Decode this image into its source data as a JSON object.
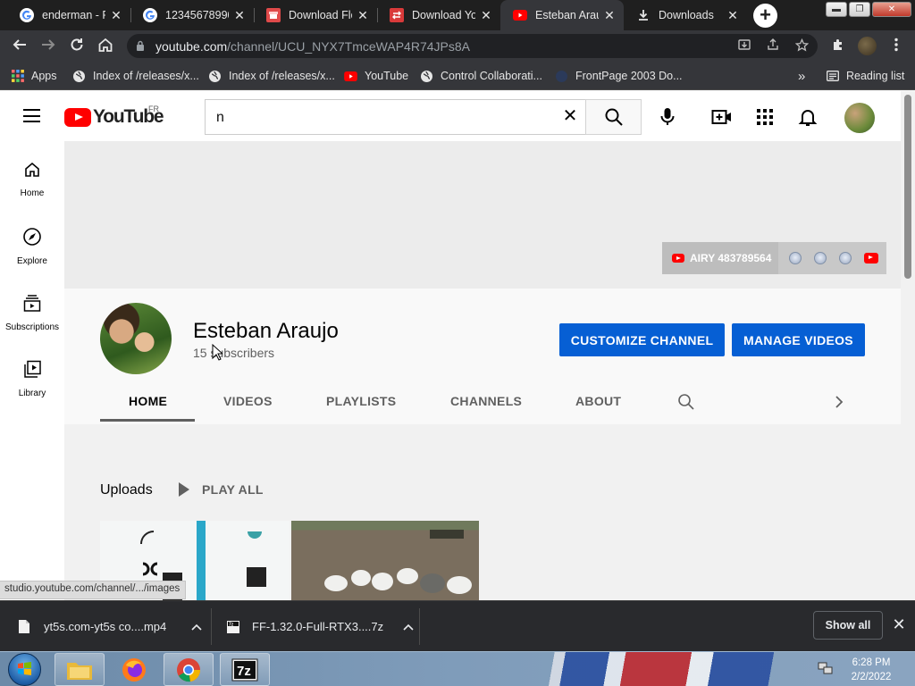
{
  "browser": {
    "tabs": [
      {
        "title": "enderman - R",
        "icon": "google-icon"
      },
      {
        "title": "12345678990",
        "icon": "google-icon"
      },
      {
        "title": "Download Flo",
        "icon": "store-icon"
      },
      {
        "title": "Download Yo",
        "icon": "download-site-icon"
      },
      {
        "title": "Esteban Arau",
        "icon": "youtube-icon"
      },
      {
        "title": "Downloads",
        "icon": "download-icon"
      }
    ],
    "url_host": "youtube.com",
    "url_path": "/channel/UCU_NYX7TmceWAP4R74JPs8A",
    "bookmarks": [
      {
        "label": "Apps",
        "icon": "apps-grid-icon"
      },
      {
        "label": "Index of /releases/x...",
        "icon": "globe-icon"
      },
      {
        "label": "Index of /releases/x...",
        "icon": "globe-icon"
      },
      {
        "label": "YouTube",
        "icon": "youtube-icon"
      },
      {
        "label": "Control Collaborati...",
        "icon": "globe-icon"
      },
      {
        "label": "FrontPage 2003 Do...",
        "icon": "frontpage-icon"
      }
    ],
    "more_bookmarks": "»",
    "reading_list": "Reading list"
  },
  "youtube": {
    "logo_text": "YouTube",
    "country_code": "FR",
    "search_value": "n",
    "guide": [
      {
        "label": "Home"
      },
      {
        "label": "Explore"
      },
      {
        "label": "Subscriptions"
      },
      {
        "label": "Library"
      }
    ],
    "banner_links": {
      "primary": "AIRY 483789564"
    },
    "channel": {
      "name": "Esteban Araujo",
      "subscribers": "15 subscribers",
      "customize_label": "CUSTOMIZE CHANNEL",
      "manage_label": "MANAGE VIDEOS"
    },
    "tabs": [
      "HOME",
      "VIDEOS",
      "PLAYLISTS",
      "CHANNELS",
      "ABOUT"
    ],
    "active_tab": "HOME",
    "uploads_label": "Uploads",
    "play_all_label": "PLAY ALL",
    "status_url": "studio.youtube.com/channel/.../images"
  },
  "downloads": {
    "items": [
      {
        "name": "yt5s.com-yt5s co....mp4",
        "icon": "file-icon"
      },
      {
        "name": "FF-1.32.0-Full-RTX3....7z",
        "icon": "archive-icon"
      }
    ],
    "show_all_label": "Show all"
  },
  "taskbar": {
    "time": "6:28 PM",
    "date": "2/2/2022"
  },
  "colors": {
    "youtube_red": "#ff0000",
    "button_blue": "#065fd4",
    "chrome_dark": "#35363a"
  }
}
